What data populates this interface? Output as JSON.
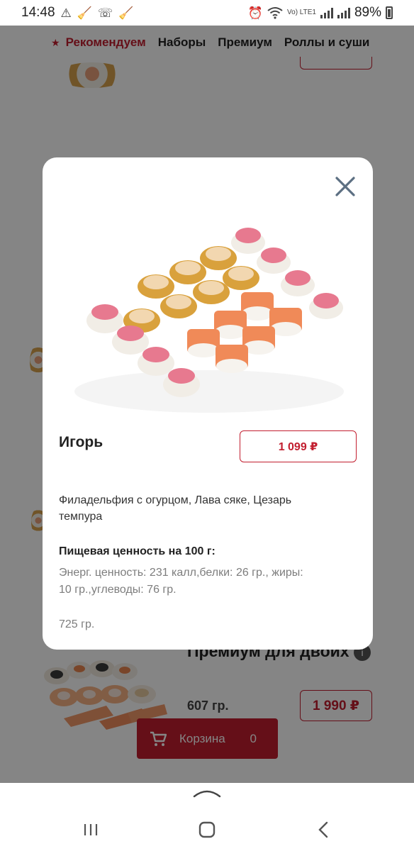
{
  "status_bar": {
    "time": "14:48",
    "left_icons": [
      "warning-icon",
      "broom-icon",
      "phone-icon",
      "broom-icon"
    ],
    "battery": "89%",
    "lte_label": "Vo) LTE1"
  },
  "category_nav": {
    "items": [
      {
        "label": "Рекомендуем",
        "active": true
      },
      {
        "label": "Наборы",
        "active": false
      },
      {
        "label": "Премиум",
        "active": false
      },
      {
        "label": "Роллы и суши",
        "active": false
      }
    ]
  },
  "background_card": {
    "title": "Премиум для двоих",
    "weight": "607 гр.",
    "price": "1 990 ₽",
    "info_badge": "i"
  },
  "cart": {
    "label": "Корзина",
    "count": "0"
  },
  "modal": {
    "product_name": "Игорь",
    "price": "1 099 ₽",
    "composition": "Филадельфия с огурцом, Лава сяке, Цезарь темпура",
    "nutrition_title": "Пищевая ценность на 100 г:",
    "nutrition_text": "Энерг. ценность: 231 калл,белки: 26 гр., жиры: 10 гр.,углеводы: 76 гр.",
    "weight": "725 гр."
  },
  "colors": {
    "accent": "#c21e2f",
    "overlay": "rgba(0,0,0,0.48)"
  }
}
